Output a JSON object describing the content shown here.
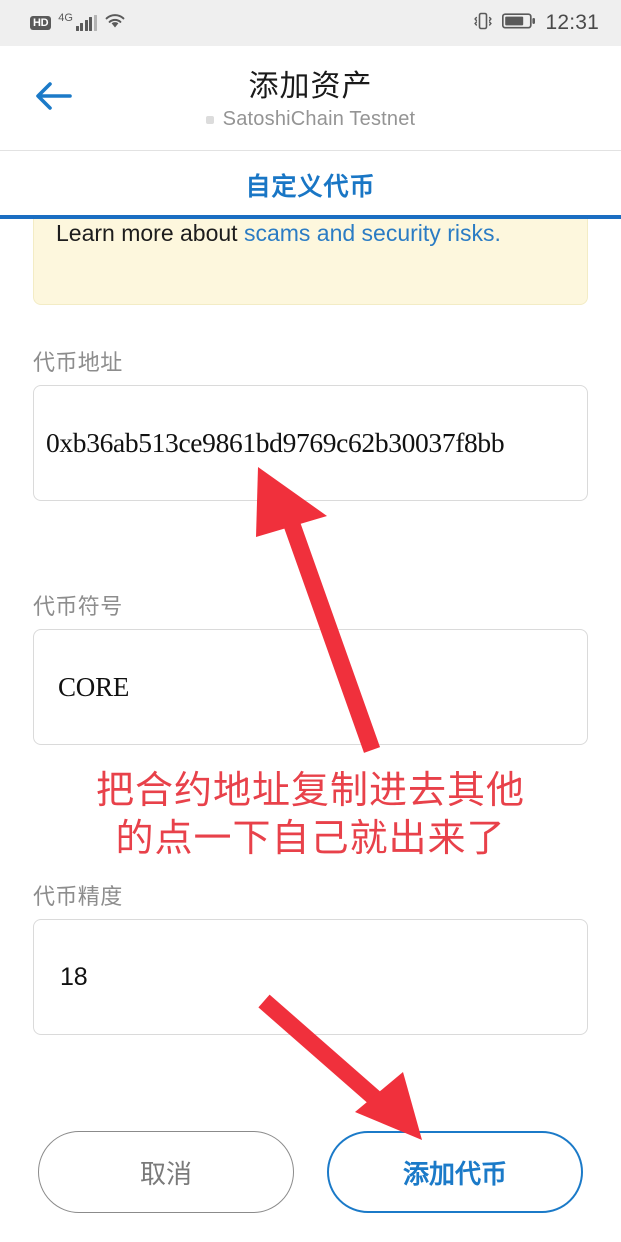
{
  "status_bar": {
    "hd_badge": "HD",
    "network_type": "4G",
    "signal_icon": "signal-bars-icon",
    "wifi_icon": "wifi-icon",
    "vibrate_icon": "vibrate-icon",
    "battery_icon": "battery-icon",
    "time": "12:31"
  },
  "header": {
    "back_icon": "back-arrow-icon",
    "title": "添加资产",
    "network_name": "SatoshiChain Testnet"
  },
  "tabs": {
    "active": "自定义代币"
  },
  "warning": {
    "text_before_link": "Learn more about ",
    "link_text": "scams and security risks."
  },
  "fields": [
    {
      "label": "代币地址",
      "value": "0xb36ab513ce9861bd9769c62b30037f8bb",
      "placeholder": ""
    },
    {
      "label": "代币符号",
      "value": "CORE",
      "placeholder": ""
    },
    {
      "label": "代币精度",
      "value": "18",
      "placeholder": ""
    }
  ],
  "annotation": {
    "line1": "把合约地址复制进去其他",
    "line2": "的点一下自己就出来了",
    "color": "#e8414a",
    "arrow_up_label": "arrow-pointing-to-token-address",
    "arrow_down_label": "arrow-pointing-to-add-token-button"
  },
  "buttons": {
    "cancel": "取消",
    "confirm": "添加代币"
  },
  "colors": {
    "accent_blue": "#1b7ac8",
    "tab_blue": "#1976c5",
    "warning_bg": "#fdf7dd",
    "annotation_red": "#e8414a"
  }
}
